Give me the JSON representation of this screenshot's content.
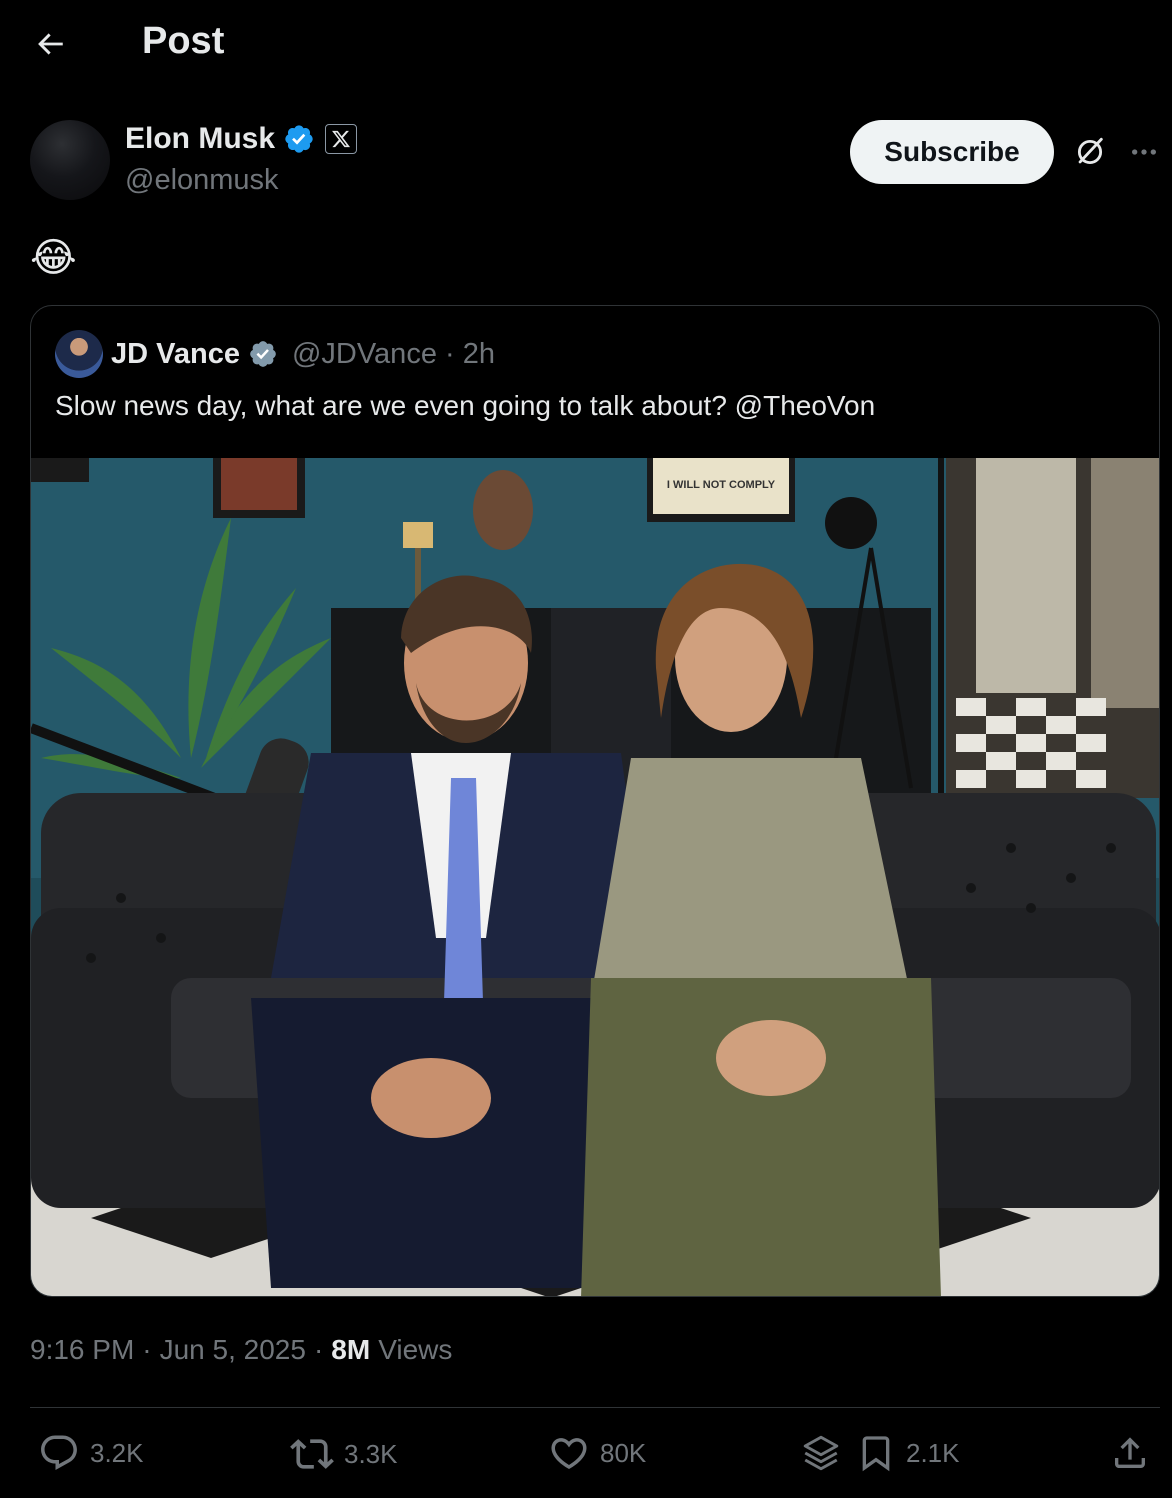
{
  "header": {
    "title": "Post"
  },
  "author": {
    "name": "Elon Musk",
    "handle": "@elonmusk",
    "subscribe_label": "Subscribe"
  },
  "post": {
    "text": "😂"
  },
  "quote": {
    "name": "JD Vance",
    "handle": "@JDVance · 2h",
    "text": "Slow news day, what are we even going to talk about? @TheoVon",
    "photo_sign_text": "I WILL NOT COMPLY"
  },
  "meta": {
    "time": "9:16 PM",
    "sep1": "·",
    "date": "Jun 5, 2025",
    "sep2": "·",
    "views_count": "8M",
    "views_label": "Views"
  },
  "actions": {
    "replies": "3.2K",
    "reposts": "3.3K",
    "likes": "80K",
    "bookmarks": "2.1K"
  },
  "colors": {
    "background": "#000000",
    "text_primary": "#e7e9ea",
    "text_secondary": "#71767b",
    "verified_blue": "#1d9bf0",
    "border": "#2f3336"
  },
  "icons": [
    "back-arrow-icon",
    "verified-icon",
    "x-logo-icon",
    "grok-icon",
    "more-icon",
    "reply-icon",
    "repost-icon",
    "like-icon",
    "grok-stack-icon",
    "bookmark-icon",
    "share-icon"
  ]
}
